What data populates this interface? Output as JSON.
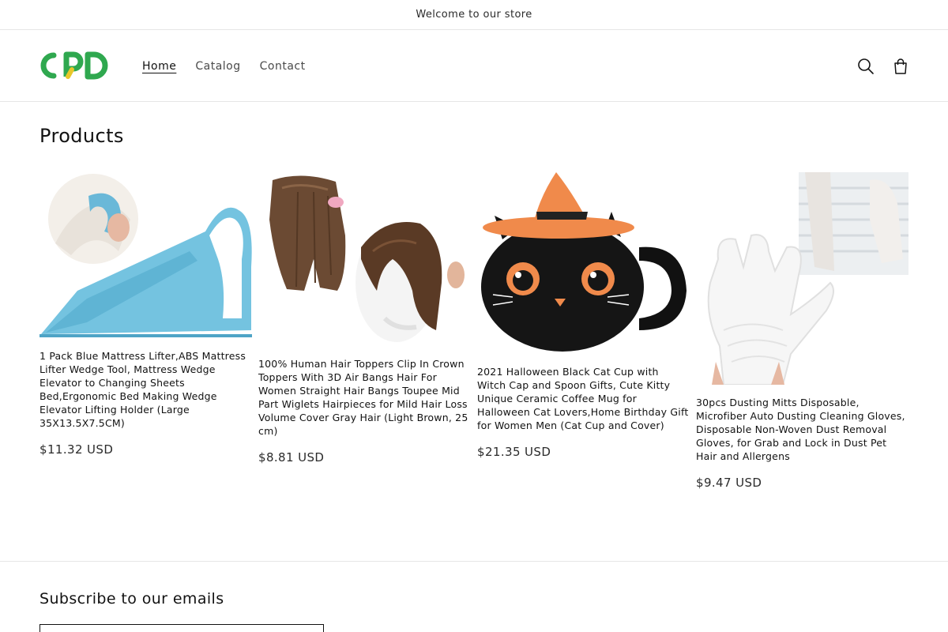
{
  "announcement": {
    "text": "Welcome to our store"
  },
  "header": {
    "logo_text": "CPD",
    "nav": [
      {
        "label": "Home",
        "active": true
      },
      {
        "label": "Catalog",
        "active": false
      },
      {
        "label": "Contact",
        "active": false
      }
    ],
    "icons": {
      "search": "search-icon",
      "cart": "cart-icon"
    }
  },
  "collection": {
    "title": "Products",
    "products": [
      {
        "name": "1 Pack Blue Mattress Lifter,ABS Mattress Lifter Wedge Tool, Mattress Wedge Elevator to Changing Sheets Bed,Ergonomic Bed Making Wedge Elevator Lifting Holder (Large 35X13.5X7.5CM)",
        "price": "$11.32 USD"
      },
      {
        "name": "100% Human Hair Toppers Clip In Crown Toppers With 3D Air Bangs Hair For Women Straight Hair Bangs Toupee Mid Part Wiglets Hairpieces for Mild Hair Loss Volume Cover Gray Hair (Light Brown, 25 cm)",
        "price": "$8.81 USD"
      },
      {
        "name": "2021 Halloween Black Cat Cup with Witch Cap and Spoon Gifts, Cute Kitty Unique Ceramic Coffee Mug for Halloween Cat Lovers,Home Birthday Gift for Women Men (Cat Cup and Cover)",
        "price": "$21.35 USD"
      },
      {
        "name": "30pcs Dusting Mitts Disposable, Microfiber Auto Dusting Cleaning Gloves, Disposable Non-Woven Dust Removal Gloves, for Grab and Lock in Dust Pet Hair and Allergens",
        "price": "$9.47 USD"
      }
    ]
  },
  "footer": {
    "subscribe_title": "Subscribe to our emails"
  },
  "colors": {
    "brand_green": "#2fa84f",
    "brand_yellow": "#e8c72a",
    "text": "#121212",
    "border": "#e6e6e6"
  }
}
